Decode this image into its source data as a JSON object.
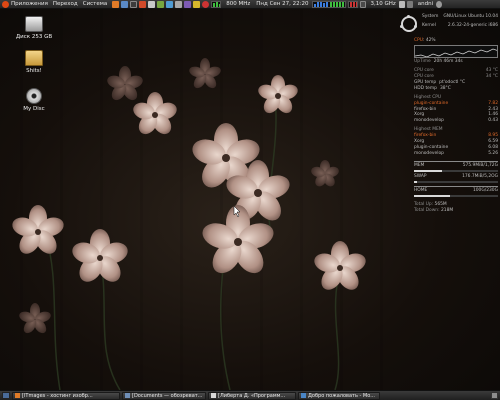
{
  "top_panel": {
    "menus": [
      "Приложения",
      "Переход",
      "Система"
    ],
    "cpu_freq_label": "800 MHz",
    "clock": "Пнд Сен 27, 22:20",
    "cpu_freq_right": "3,10 GHz",
    "user": "andni"
  },
  "desktop_icons": [
    {
      "label": "Диск 253 GB",
      "icon": "drive-icon"
    },
    {
      "label": "Shits!",
      "icon": "folder-icon"
    },
    {
      "label": "My Disc",
      "icon": "cd-icon"
    }
  ],
  "conky": {
    "system_label": "System",
    "system_value": "GNU/Linux Ubuntu 10.04",
    "kernel_label": "Kernel",
    "kernel_value": "2.6.32-24-generic i686",
    "cpu_label": "CPU",
    "cpu_percent": "42%",
    "cpu_fraction": 0.42,
    "uptime_label": "UpTime",
    "uptime_value": "20h 46m 34s",
    "sensors": [
      {
        "label": "CPU core",
        "value": "43 °C"
      },
      {
        "label": "CPU core",
        "value": "34 °C"
      },
      {
        "label": "GPU temp",
        "value": "pt'odoctl °C"
      },
      {
        "label": "HDD temp",
        "value": "38°C"
      }
    ],
    "highest_cpu_title": "Highest CPU",
    "highest_cpu": [
      {
        "name": "plugin-containe",
        "value": "7.82"
      },
      {
        "name": "firefox-bin",
        "value": "2.43"
      },
      {
        "name": "Xorg",
        "value": "1.46"
      },
      {
        "name": "monodevelop",
        "value": "0.43"
      }
    ],
    "highest_mem_title": "Highest MEM",
    "highest_mem": [
      {
        "name": "firefox-bin",
        "value": "8.95"
      },
      {
        "name": "Xorg",
        "value": "6.59"
      },
      {
        "name": "plugin-containe",
        "value": "6.08"
      },
      {
        "name": "monodevelop",
        "value": "5.26"
      }
    ],
    "mem_label": "MEM",
    "mem_value": "575.9MiB/1,72G",
    "mem_fraction": 0.33,
    "swap_label": "SWAP",
    "swap_value": "176.7MiB/5,2OG",
    "swap_fraction": 0.04,
    "home_label": "HOME",
    "home_value": "100G/230G",
    "home_fraction": 0.43,
    "net_rows": [
      {
        "label": "Total Up:",
        "value": "565M"
      },
      {
        "label": "Total Down:",
        "value": "218M"
      }
    ]
  },
  "taskbar": [
    {
      "label": "[ITmages - хостинг изобр..."
    },
    {
      "label": "[Documents — обозреват..."
    },
    {
      "label": "[Либерта Д. «Программ..."
    },
    {
      "label": "Добро пожаловать - Мо..."
    }
  ]
}
